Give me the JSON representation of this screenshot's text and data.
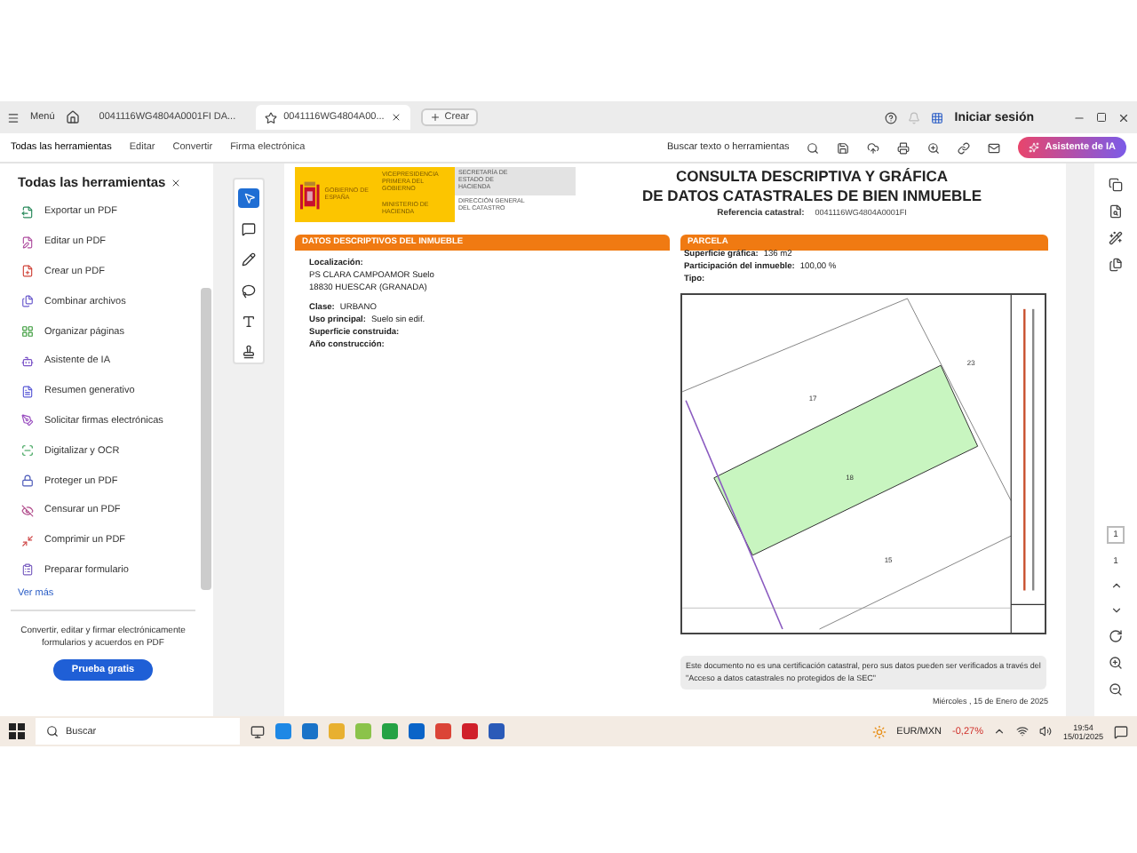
{
  "window": {
    "menu_label": "Menú",
    "tabs": [
      {
        "label": "0041116WG4804A0001FI DA...",
        "selected": false
      },
      {
        "label": "0041116WG4804A00...",
        "selected": true
      }
    ],
    "new_tab": "Crear",
    "account": "Iniciar sesión"
  },
  "toolbar": {
    "menus": [
      "Todas las herramientas",
      "Editar",
      "Convertir",
      "Firma electrónica"
    ],
    "search": "Buscar texto o herramientas",
    "ai_button": "Asistente de IA"
  },
  "tools_panel": {
    "title": "Todas las herramientas",
    "items": [
      "Exportar un PDF",
      "Editar un PDF",
      "Crear un PDF",
      "Combinar archivos",
      "Organizar páginas",
      "Asistente de IA",
      "Resumen generativo",
      "Solicitar firmas electrónicas",
      "Digitalizar y OCR",
      "Proteger un PDF",
      "Censurar un PDF",
      "Comprimir un PDF",
      "Preparar formulario"
    ],
    "more": "Ver más",
    "promo": "Convertir, editar y firmar electrónicamente formularios y acuerdos en PDF",
    "promo_button": "Prueba gratis"
  },
  "document": {
    "gov": "GOBIERNO DE ESPAÑA",
    "vice": "VICEPRESIDENCIA PRIMERA DEL GOBIERNO",
    "ministry": "MINISTERIO DE HACIENDA",
    "secretary": "SECRETARÍA DE ESTADO DE HACIENDA",
    "directorate": "DIRECCIÓN GENERAL DEL CATASTRO",
    "title_lines": [
      "CONSULTA DESCRIPTIVA Y GRÁFICA",
      "DE DATOS CATASTRALES DE BIEN INMUEBLE"
    ],
    "reference_label": "Referencia catastral:",
    "reference": "0041116WG4804A0001FI",
    "descriptive": {
      "heading": "DATOS DESCRIPTIVOS DEL INMUEBLE",
      "location_label": "Localización:",
      "location_lines": [
        "PS CLARA CAMPOAMOR Suelo",
        "18830 HUESCAR (GRANADA)"
      ],
      "fields": [
        {
          "label": "Clase:",
          "value": "URBANO"
        },
        {
          "label": "Uso principal:",
          "value": "Suelo sin edif."
        },
        {
          "label": "Superficie construida:"
        },
        {
          "label": "Año construcción:"
        }
      ]
    },
    "parcel": {
      "heading": "PARCELA",
      "fields": [
        {
          "label": "Superficie gráfica:",
          "value": "136 m2"
        },
        {
          "label": "Participación del inmueble:",
          "value": "100,00 %"
        },
        {
          "label": "Tipo:"
        }
      ],
      "plot_labels": [
        "17",
        "23",
        "18",
        "15"
      ]
    },
    "note": "Este documento no es una certificación catastral, pero sus datos pueden ser verificados a través del \"Acceso a datos catastrales no protegidos de la SEC\"",
    "date": "Miércoles , 15 de Enero de 2025"
  },
  "page_nav": {
    "current": "1",
    "total": "1"
  },
  "taskbar": {
    "search": "Buscar",
    "ticker": "EUR/MXN",
    "change": "-0,27%",
    "time": "19:54",
    "date": "15/01/2025"
  }
}
